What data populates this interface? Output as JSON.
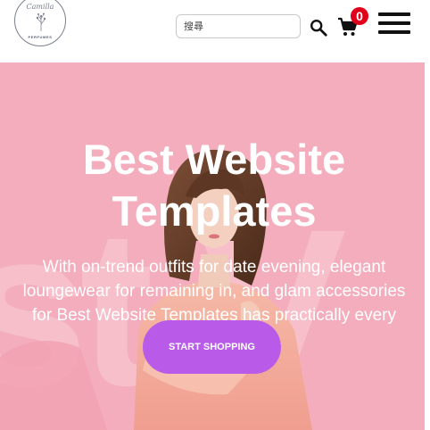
{
  "header": {
    "logo": {
      "name": "Camilla",
      "subtitle": "PERFUMES"
    },
    "search": {
      "placeholder": "搜尋"
    },
    "cart": {
      "count": "0"
    },
    "icons": {
      "search": "search-icon",
      "cart": "cart-icon",
      "menu": "hamburger-menu-icon"
    }
  },
  "hero": {
    "title": "Best Website Templates",
    "description": "With on-trend outfits for date evening, elegant loungewear for remaining in, and glam accessories for Best Website Templates has practically every occasion covered.",
    "cta_label": "START SHOPPING",
    "background_letters": "st V"
  },
  "colors": {
    "hero_background": "#f4adbc",
    "cta": "#b95ae8",
    "badge": "#e0001b"
  }
}
